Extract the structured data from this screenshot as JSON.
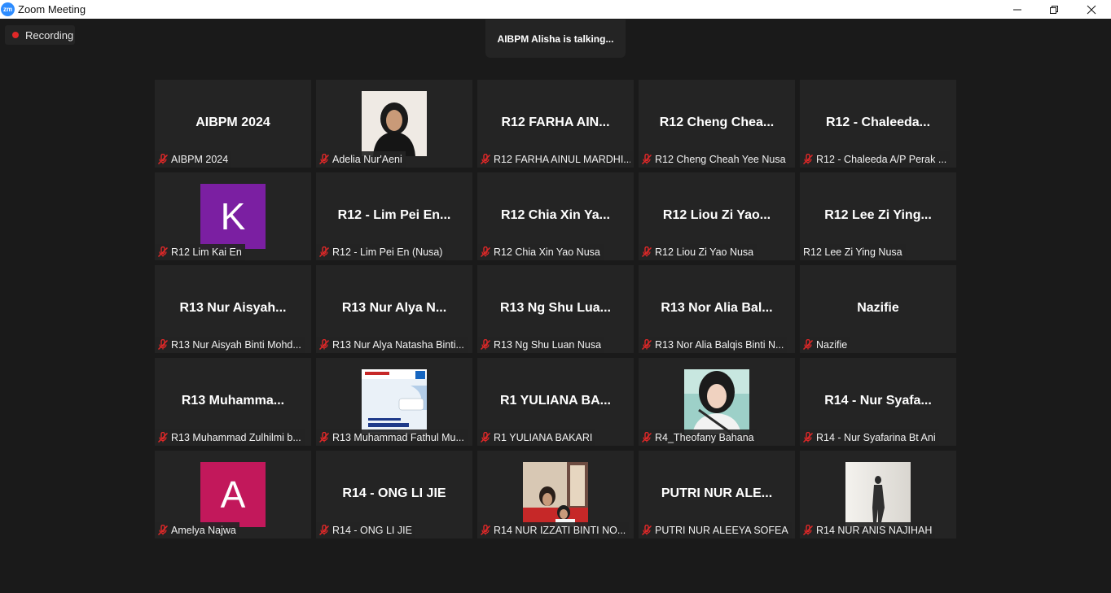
{
  "window": {
    "title": "Zoom Meeting",
    "logo_text": "zm"
  },
  "recording": {
    "label": "Recording"
  },
  "banner": {
    "talking": "AIBPM Alisha is talking..."
  },
  "colors": {
    "avatar_k": "#7b1fa2",
    "avatar_a": "#c2185b",
    "mute": "#e02828"
  },
  "rows": [
    [
      {
        "display": "AIBPM 2024",
        "tag": "AIBPM 2024",
        "muted": true
      },
      {
        "photo": "hijab-portrait",
        "tag": "Adelia Nur'Aeni",
        "muted": true
      },
      {
        "display": "R12 FARHA AIN...",
        "tag": "R12 FARHA AINUL MARDHI...",
        "muted": true
      },
      {
        "display": "R12  Cheng Chea...",
        "tag": "R12 Cheng Cheah Yee Nusa",
        "muted": true
      },
      {
        "display": "R12  - Chaleeda...",
        "tag": "R12 - Chaleeda A/P Perak ...",
        "muted": true
      }
    ],
    [
      {
        "avatar": "K",
        "tag": "R12 Lim Kai En",
        "muted": true
      },
      {
        "display": "R12 - Lim Pei En...",
        "tag": "R12 - Lim Pei En (Nusa)",
        "muted": true
      },
      {
        "display": "R12 Chia Xin Ya...",
        "tag": "R12 Chia Xin Yao Nusa",
        "muted": true
      },
      {
        "display": "R12 Liou Zi Yao...",
        "tag": "R12 Liou Zi Yao Nusa",
        "muted": true
      },
      {
        "display": "R12 Lee Zi Ying...",
        "tag": "R12 Lee Zi Ying Nusa",
        "muted": false
      }
    ],
    [
      {
        "display": "R13 Nur Aisyah...",
        "tag": "R13 Nur Aisyah Binti Mohd...",
        "muted": true
      },
      {
        "display": "R13 Nur Alya N...",
        "tag": "R13 Nur Alya Natasha Binti...",
        "muted": true
      },
      {
        "display": "R13 Ng Shu Lua...",
        "tag": "R13 Ng Shu Luan  Nusa",
        "muted": true
      },
      {
        "display": "R13 Nor Alia Bal...",
        "tag": "R13 Nor Alia Balqis Binti N...",
        "muted": true
      },
      {
        "display": "Nazifie",
        "tag": "Nazifie",
        "muted": true
      }
    ],
    [
      {
        "display": "R13  Muhamma...",
        "tag": "R13 Muhammad Zulhilmi b...",
        "muted": true
      },
      {
        "photo": "poster",
        "tag": "R13 Muhammad Fathul Mu...",
        "muted": true
      },
      {
        "display": "R1 YULIANA BA...",
        "tag": "R1 YULIANA BAKARI",
        "muted": true
      },
      {
        "photo": "selfie-portrait",
        "tag": "R4_Theofany Bahana",
        "muted": true
      },
      {
        "display": "R14 - Nur Syafa...",
        "tag": "R14 - Nur Syafarina Bt Ani",
        "muted": true
      }
    ],
    [
      {
        "avatar": "A",
        "tag": "Amelya Najwa",
        "muted": true
      },
      {
        "display": "R14 - ONG LI JIE",
        "tag": "R14 - ONG LI JIE",
        "muted": true
      },
      {
        "photo": "family-room",
        "tag": "R14 NUR IZZATI BINTI NO...",
        "muted": true
      },
      {
        "display": "PUTRI NUR ALE...",
        "tag": "PUTRI NUR ALEEYA SOFEA",
        "muted": true
      },
      {
        "photo": "walking-figure",
        "tag": "R14 NUR ANIS NAJIHAH",
        "muted": true
      }
    ]
  ]
}
